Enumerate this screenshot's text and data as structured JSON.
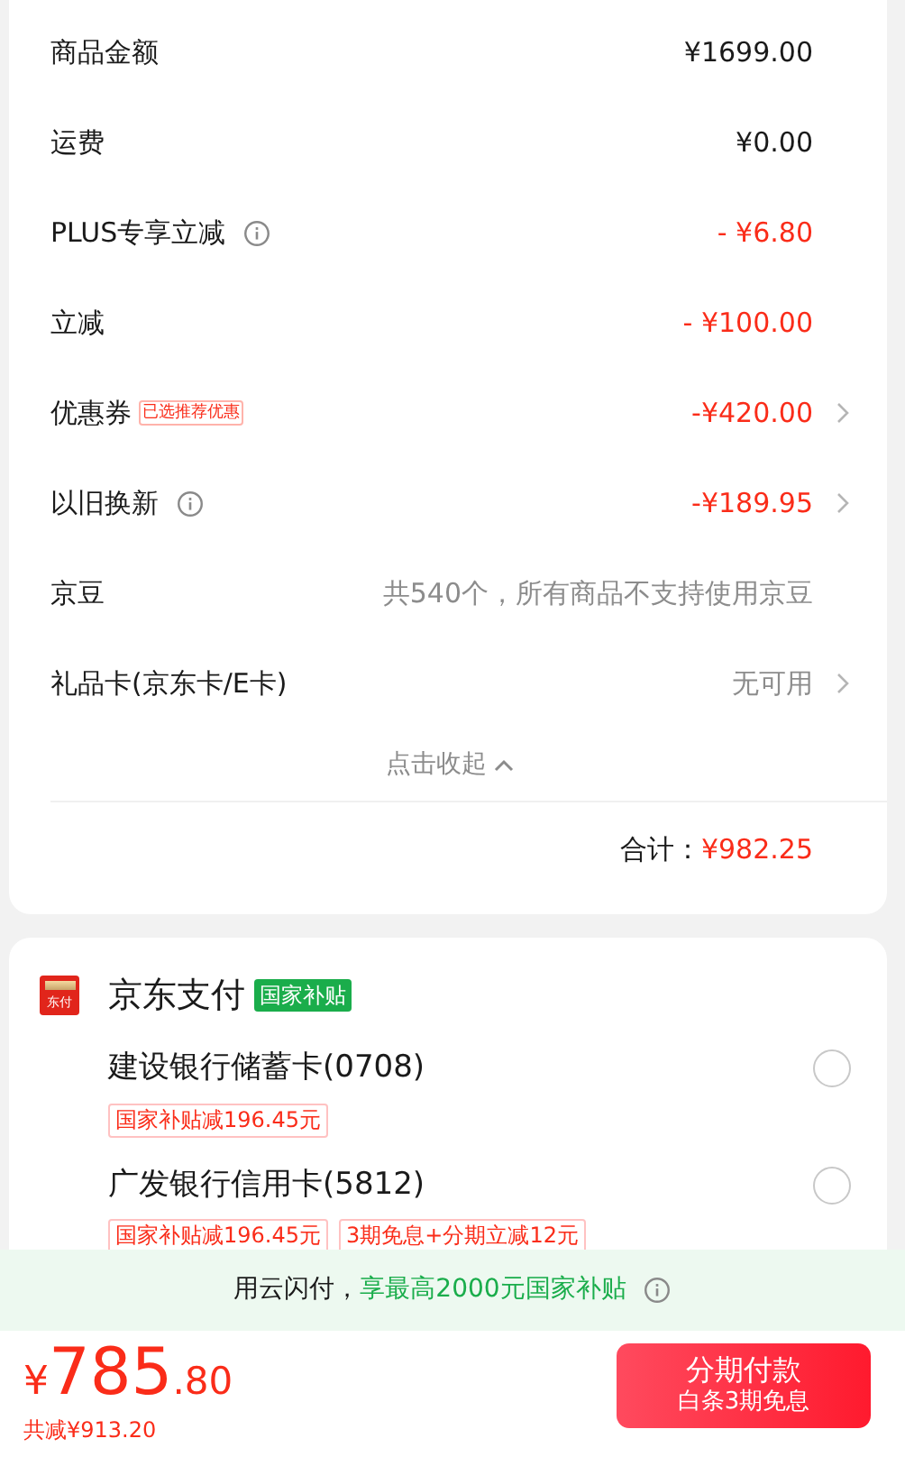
{
  "summary": {
    "rows": [
      {
        "label": "商品金额",
        "info": false,
        "value": "¥1699.00",
        "kind": "normal",
        "chevron": false
      },
      {
        "label": "运费",
        "info": false,
        "value": "¥0.00",
        "kind": "normal",
        "chevron": false
      },
      {
        "label": "PLUS专享立减",
        "info": true,
        "value": "- ¥6.80",
        "kind": "discount",
        "chevron": false
      },
      {
        "label": "立减",
        "info": false,
        "value": "- ¥100.00",
        "kind": "discount",
        "chevron": false
      },
      {
        "label": "优惠券",
        "info": false,
        "badge": "已选推荐优惠",
        "value": "-¥420.00",
        "kind": "discount",
        "chevron": true
      },
      {
        "label": "以旧换新",
        "info": true,
        "value": "-¥189.95",
        "kind": "discount",
        "chevron": true
      },
      {
        "label": "京豆",
        "info": false,
        "value": "共540个，所有商品不支持使用京豆",
        "kind": "muted",
        "chevron": false
      },
      {
        "label": "礼品卡(京东卡/E卡)",
        "info": false,
        "value": "无可用",
        "kind": "muted",
        "chevron": true
      }
    ],
    "collapse": "点击收起",
    "total_label": "合计：",
    "total": "¥982.25"
  },
  "payment": {
    "icon_text": "东付",
    "title": "京东支付",
    "badge": "国家补贴",
    "options": [
      {
        "name": "建设银行储蓄卡(0708)",
        "selected": false,
        "tags": [
          "国家补贴减196.45元"
        ]
      },
      {
        "name": "广发银行信用卡(5812)",
        "selected": false,
        "tags": [
          "国家补贴减196.45元",
          "3期免息+分期立减12元"
        ]
      }
    ]
  },
  "banner": {
    "text": "用云闪付，",
    "highlight": "享最高2000元国家补贴"
  },
  "footer": {
    "currency": "¥",
    "amount": "785",
    "cents": ".80",
    "saved": "共减¥913.20",
    "button_title": "分期付款",
    "button_subtitle": "白条3期免息"
  }
}
